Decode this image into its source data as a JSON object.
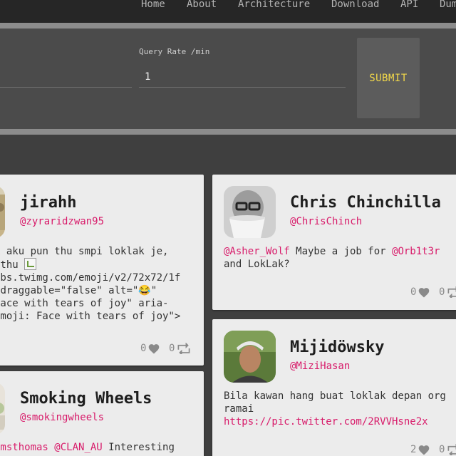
{
  "nav": {
    "items": [
      "Home",
      "About",
      "Architecture",
      "Download",
      "API",
      "Dum"
    ]
  },
  "form": {
    "query_rate_label": "Query Rate /min",
    "query_rate_value": "1",
    "submit_label": "SUBMIT"
  },
  "cards": [
    {
      "name": "jirahh",
      "handle": "@zyraridzwan95",
      "text_prefix": "k",
      "text_line1": " aku pun thu smpi loklak je,",
      "text_line2a": "tthu ",
      "text_rest": "abs.twimg.com/emoji/v2/72x72/1f\n draggable=\"false\" alt=\"😂\"\nface with tears of joy\" aria-\nEmoji: Face with tears of joy\">",
      "likes": "0",
      "retweets": "0"
    },
    {
      "name": "Chris Chinchilla",
      "handle": "@ChrisChinch",
      "mention1": "@Asher_Wolf",
      "text_mid": " Maybe a job for ",
      "mention2": "@Orb1t3r",
      "text_end": "and LokLak?",
      "likes": "0",
      "retweets": "0"
    },
    {
      "name": "Smoking Wheels",
      "handle": "@smokingwheels",
      "mention1": "amsthomas",
      "mention2": "@CLAN_AU",
      "text_end": " Interesting"
    },
    {
      "name": "Mijidöwsky",
      "handle": "@MiziHasan",
      "text": "Bila kawan hang buat loklak depan org\nramai",
      "link": "https://pic.twitter.com/2RVVHsne2x",
      "likes": "2",
      "retweets": "0"
    }
  ],
  "colors": {
    "accent_pink": "#d81b6a",
    "submit_text": "#f2d84a"
  },
  "icons": {
    "like": "heart-icon",
    "retweet": "retweet-icon"
  }
}
